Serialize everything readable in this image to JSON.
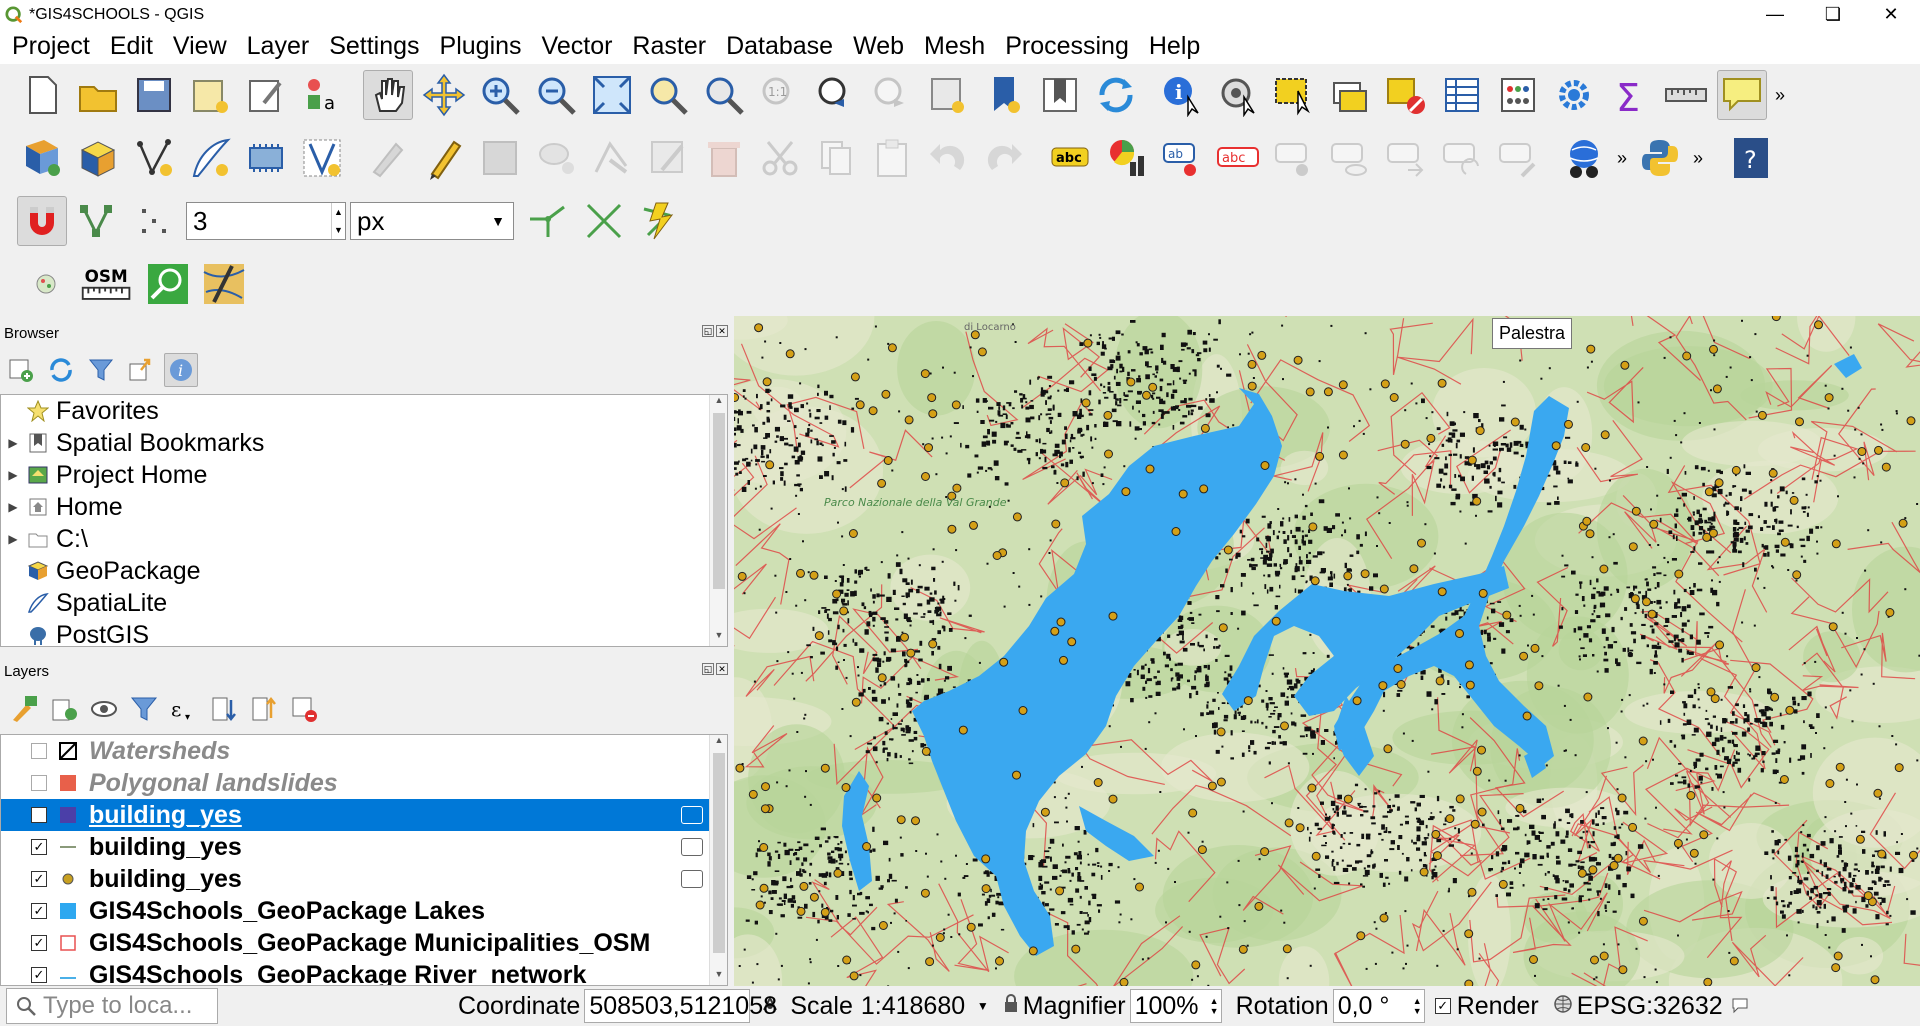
{
  "window": {
    "title": "*GIS4SCHOOLS - QGIS",
    "controls": [
      "minimize",
      "restore",
      "close"
    ]
  },
  "menubar": [
    "Project",
    "Edit",
    "View",
    "Layer",
    "Settings",
    "Plugins",
    "Vector",
    "Raster",
    "Database",
    "Web",
    "Mesh",
    "Processing",
    "Help"
  ],
  "snapping": {
    "tolerance_value": "3",
    "tolerance_unit": "px"
  },
  "toolbar_osm_label": "OSM",
  "browser": {
    "title": "Browser",
    "items": [
      {
        "label": "Favorites",
        "icon": "star-icon",
        "expandable": false
      },
      {
        "label": "Spatial Bookmarks",
        "icon": "bookmark-icon",
        "expandable": true
      },
      {
        "label": "Project Home",
        "icon": "project-home-icon",
        "expandable": true
      },
      {
        "label": "Home",
        "icon": "home-icon",
        "expandable": true
      },
      {
        "label": "C:\\",
        "icon": "drive-icon",
        "expandable": true
      },
      {
        "label": "GeoPackage",
        "icon": "geopackage-icon",
        "expandable": false
      },
      {
        "label": "SpatiaLite",
        "icon": "spatialite-icon",
        "expandable": false
      },
      {
        "label": "PostGIS",
        "icon": "postgis-icon",
        "expandable": false
      }
    ]
  },
  "layers": {
    "title": "Layers",
    "items": [
      {
        "label": "Watersheds",
        "checked": false,
        "symbol": "hatched-box",
        "color": "#ffffff"
      },
      {
        "label": "Polygonal landslides",
        "checked": false,
        "symbol": "fill",
        "color": "#e8604a"
      },
      {
        "label": "building_yes",
        "checked": true,
        "symbol": "fill",
        "color": "#4b3fa8",
        "selected": true,
        "filter": true
      },
      {
        "label": "building_yes",
        "checked": true,
        "symbol": "line",
        "color": "#8a9a7a",
        "filter": true
      },
      {
        "label": "building_yes",
        "checked": true,
        "symbol": "point",
        "color": "#c8a020",
        "filter": true
      },
      {
        "label": "GIS4Schools_GeoPackage Lakes",
        "checked": true,
        "symbol": "fill",
        "color": "#2ea8f0"
      },
      {
        "label": "GIS4Schools_GeoPackage Municipalities_OSM",
        "checked": true,
        "symbol": "outline",
        "color": "#e85050"
      },
      {
        "label": "GIS4Schools_GeoPackage River_network",
        "checked": true,
        "symbol": "line",
        "color": "#4ab0e8"
      }
    ]
  },
  "map": {
    "tooltip": "Palestra",
    "labels": [
      "di Locarno",
      "Parco Nazionale della Val Grande"
    ],
    "colors": {
      "lake": "#3aa8f0",
      "land": "#cfe0b4",
      "boundary": "#e04040",
      "buildings": "#111111",
      "points": "#d4a017"
    }
  },
  "statusbar": {
    "locator_placeholder": "Type to loca...",
    "coordinate_label": "Coordinate",
    "coordinate_value": "508503,5121058",
    "scale_label": "Scale",
    "scale_value": "1:418680",
    "magnifier_label": "Magnifier",
    "magnifier_value": "100%",
    "rotation_label": "Rotation",
    "rotation_value": "0,0 °",
    "render_label": "Render",
    "render_checked": true,
    "crs": "EPSG:32632"
  }
}
